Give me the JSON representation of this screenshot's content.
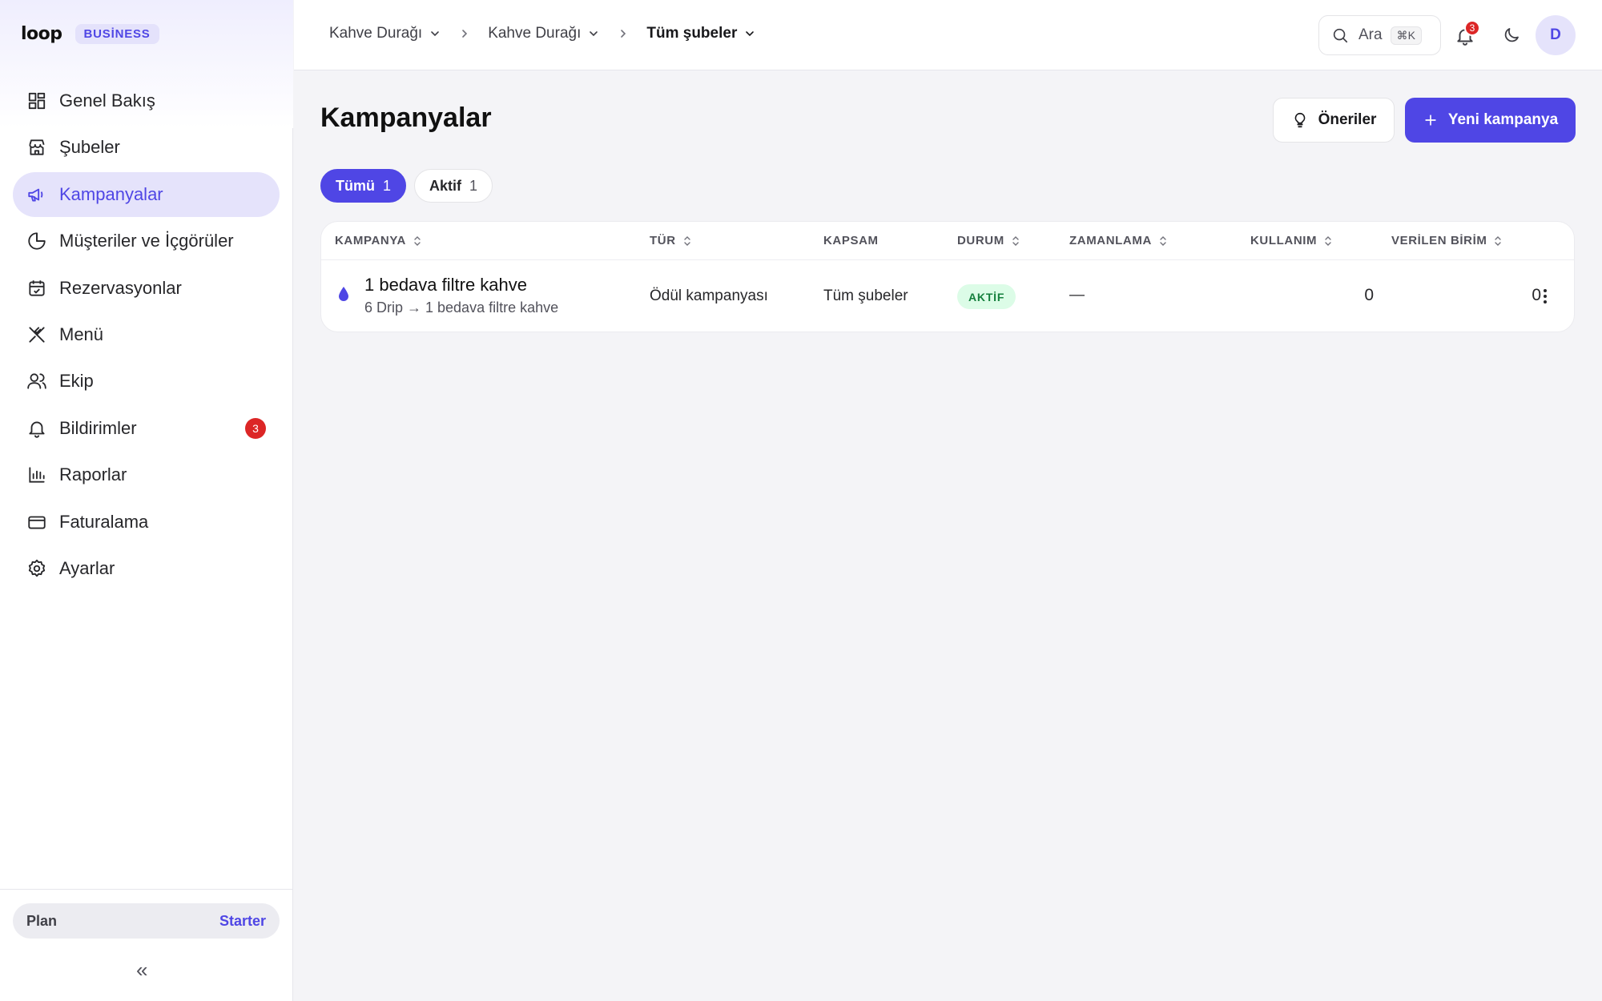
{
  "brand": {
    "logo": "loop",
    "badge": "BUSİNESS"
  },
  "sidebar": {
    "items": [
      {
        "label": "Genel Bakış",
        "icon": "dashboard-icon"
      },
      {
        "label": "Şubeler",
        "icon": "store-icon"
      },
      {
        "label": "Kampanyalar",
        "icon": "megaphone-icon",
        "active": true
      },
      {
        "label": "Müşteriler ve İçgörüler",
        "icon": "pie-chart-icon"
      },
      {
        "label": "Rezervasyonlar",
        "icon": "calendar-check-icon"
      },
      {
        "label": "Menü",
        "icon": "utensils-icon"
      },
      {
        "label": "Ekip",
        "icon": "users-icon"
      },
      {
        "label": "Bildirimler",
        "icon": "bell-icon",
        "badge": "3"
      },
      {
        "label": "Raporlar",
        "icon": "bar-chart-icon"
      },
      {
        "label": "Faturalama",
        "icon": "credit-card-icon"
      },
      {
        "label": "Ayarlar",
        "icon": "gear-icon"
      }
    ],
    "plan": {
      "label": "Plan",
      "value": "Starter"
    },
    "collapse": "«"
  },
  "header": {
    "breadcrumb": [
      "Kahve Durağı",
      "Kahve Durağı",
      "Tüm şubeler"
    ],
    "search": {
      "label": "Ara",
      "shortcut": "⌘K"
    },
    "notifications_count": "3",
    "avatar_initial": "D"
  },
  "main": {
    "title": "Kampanyalar",
    "suggest_button": "Öneriler",
    "new_button": "Yeni kampanya",
    "filters": [
      {
        "label": "Tümü",
        "count": "1",
        "active": true
      },
      {
        "label": "Aktif",
        "count": "1",
        "active": false
      }
    ],
    "table": {
      "columns": [
        "KAMPANYA",
        "TÜR",
        "KAPSAM",
        "DURUM",
        "ZAMANLAMA",
        "KULLANIM",
        "VERİLEN BİRİM"
      ],
      "rows": [
        {
          "name": "1 bedava filtre kahve",
          "description": "6 Drip → 1 bedava filtre kahve",
          "type": "Ödül kampanyası",
          "scope": "Tüm şubeler",
          "status": "AKTİF",
          "schedule": "—",
          "usage": "0",
          "units_given": "0"
        }
      ]
    }
  },
  "colors": {
    "accent": "#4f46e5",
    "status_active_bg": "#dcfce7",
    "status_active_text": "#15803d",
    "badge_red": "#dc2626"
  }
}
